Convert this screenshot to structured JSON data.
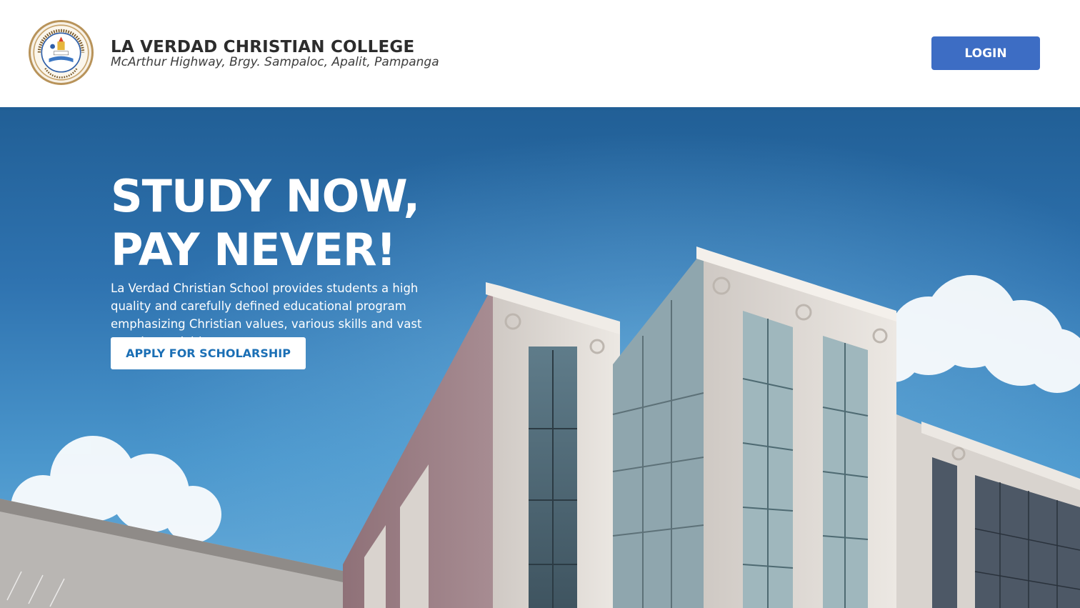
{
  "header": {
    "title": "LA VERDAD CHRISTIAN COLLEGE",
    "subtitle": "McArthur Highway, Brgy. Sampaloc, Apalit, Pampanga",
    "logo_icon": "school-seal-logo",
    "login_label": "LOGIN"
  },
  "hero": {
    "headline_line1": "STUDY NOW,",
    "headline_line2": "PAY NEVER!",
    "description": "La Verdad Christian School provides students a high quality and carefully defined educational program emphasizing Christian values, various skills and vast creative activities.",
    "cta_label": "APPLY FOR SCHOLARSHIP",
    "background_icon": "college-building-photo"
  },
  "colors": {
    "login_button": "#3d6dc4",
    "cta_text": "#1b6fb5",
    "sky_top": "#215f96",
    "sky_bottom": "#6aaedb"
  }
}
